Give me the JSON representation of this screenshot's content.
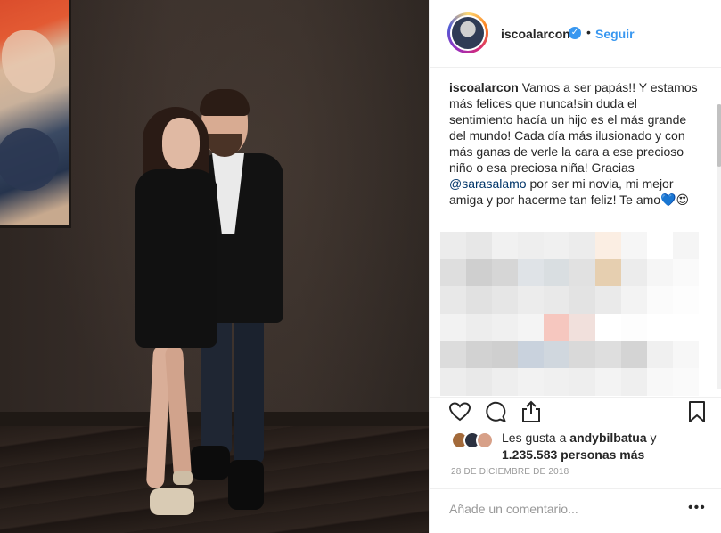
{
  "post": {
    "username": "iscoalarcon",
    "verified_icon": "verified-badge-icon",
    "separator": "•",
    "follow_label": "Seguir",
    "caption_user": "iscoalarcon",
    "caption_part1": "Vamos a ser papás!! Y estamos más felices que nunca!sin duda el sentimiento hacía un hijo es el más grande del mundo! Cada día más ilusionado y con más ganas de verle la cara a ese precioso niño o esa preciosa niña! Gracias ",
    "caption_mention": "@sarasalamo",
    "caption_part2": " por ser mi novia, mi mejor amiga y por hacerme tan feliz! Te amo",
    "caption_emojis": "💙😍",
    "likes_prefix": "Les gusta a ",
    "likes_user": "andybilbatua",
    "likes_suffix": " y",
    "likes_count": "1.235.583 personas más",
    "date": "28 DE DICIEMBRE DE 2018",
    "comment_placeholder": "Añade un comentario...",
    "more_label": "•••"
  },
  "colors": {
    "link_blue": "#3897f0",
    "mention_blue": "#003569",
    "text": "#262626",
    "muted": "#999999",
    "border": "#efefef"
  },
  "icons": [
    "heart-icon",
    "comment-icon",
    "share-icon",
    "bookmark-icon",
    "verified-badge-icon",
    "more-options-icon"
  ]
}
